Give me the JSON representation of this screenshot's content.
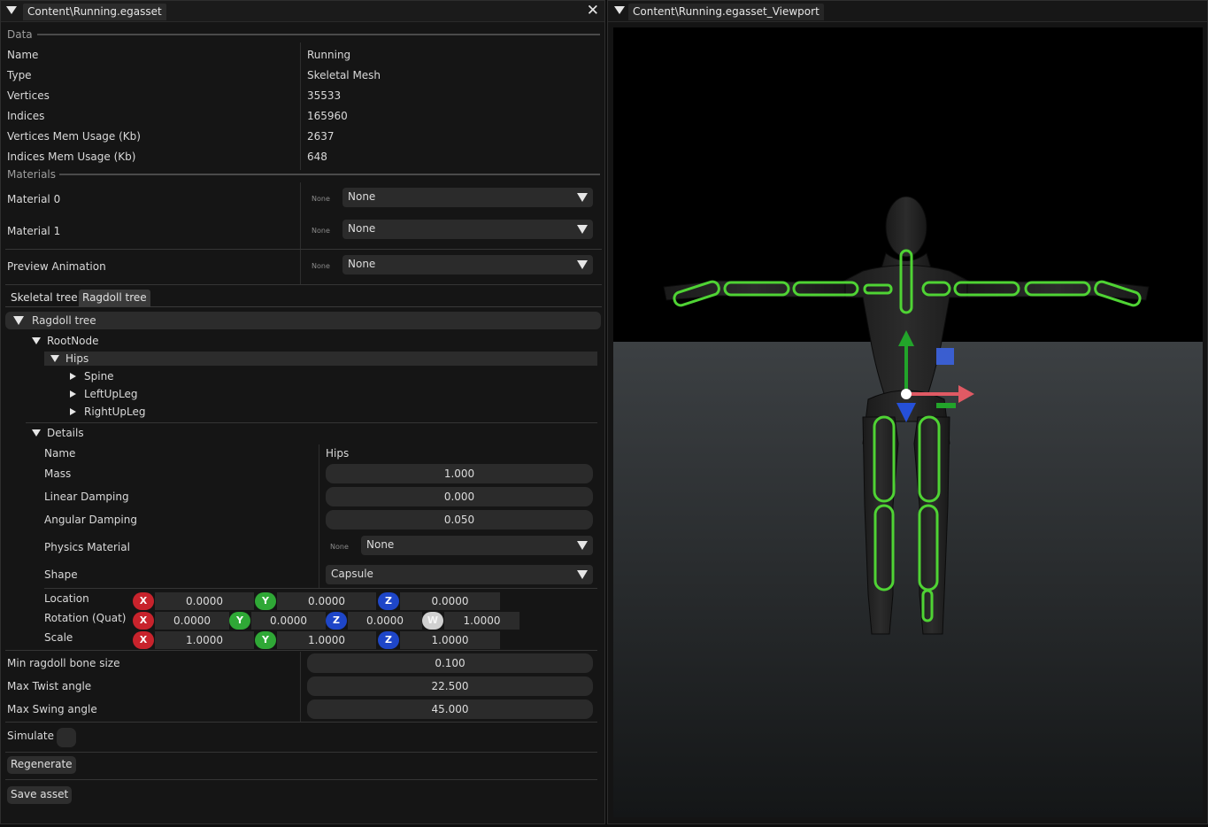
{
  "left_window": {
    "title": "Content\\Running.egasset",
    "data_section": {
      "title": "Data",
      "rows": [
        {
          "label": "Name",
          "value": "Running"
        },
        {
          "label": "Type",
          "value": "Skeletal Mesh"
        },
        {
          "label": "Vertices",
          "value": "35533"
        },
        {
          "label": "Indices",
          "value": "165960"
        },
        {
          "label": "Vertices Mem Usage (Kb)",
          "value": "2637"
        },
        {
          "label": "Indices Mem Usage (Kb)",
          "value": "648"
        }
      ]
    },
    "materials_section": {
      "title": "Materials",
      "rows": [
        {
          "label": "Material 0",
          "tag": "None",
          "value": "None"
        },
        {
          "label": "Material 1",
          "tag": "None",
          "value": "None"
        }
      ]
    },
    "preview_animation": {
      "label": "Preview Animation",
      "tag": "None",
      "value": "None"
    },
    "tabs": [
      "Skeletal tree",
      "Ragdoll tree"
    ],
    "ragdoll": {
      "header": "Ragdoll tree",
      "root": "RootNode",
      "selected": "Hips",
      "children": [
        "Spine",
        "LeftUpLeg",
        "RightUpLeg"
      ],
      "details_title": "Details",
      "details": {
        "name_label": "Name",
        "name_value": "Hips",
        "mass_label": "Mass",
        "mass_value": "1.000",
        "linear_label": "Linear Damping",
        "linear_value": "0.000",
        "angular_label": "Angular Damping",
        "angular_value": "0.050",
        "physmat_label": "Physics Material",
        "physmat_tag": "None",
        "physmat_value": "None",
        "shape_label": "Shape",
        "shape_value": "Capsule",
        "location_label": "Location",
        "location": [
          "0.0000",
          "0.0000",
          "0.0000"
        ],
        "rotation_label": "Rotation (Quat)",
        "rotation": [
          "0.0000",
          "0.0000",
          "0.0000",
          "1.0000"
        ],
        "scale_label": "Scale",
        "scale": [
          "1.0000",
          "1.0000",
          "1.0000"
        ],
        "axes": [
          "X",
          "Y",
          "Z",
          "W"
        ]
      }
    },
    "settings": {
      "min_bone_label": "Min ragdoll bone size",
      "min_bone_value": "0.100",
      "twist_label": "Max Twist angle",
      "twist_value": "22.500",
      "swing_label": "Max Swing angle",
      "swing_value": "45.000",
      "simulate_label": "Simulate"
    },
    "regenerate_label": "Regenerate",
    "save_label": "Save asset"
  },
  "right_window": {
    "title": "Content\\Running.egasset_Viewport"
  },
  "colors": {
    "collider_green": "#4fd334",
    "gizmo_x": "#e05a64",
    "gizmo_y": "#22a42a",
    "gizmo_z": "#2550d8",
    "floor": "#3a3e41"
  }
}
